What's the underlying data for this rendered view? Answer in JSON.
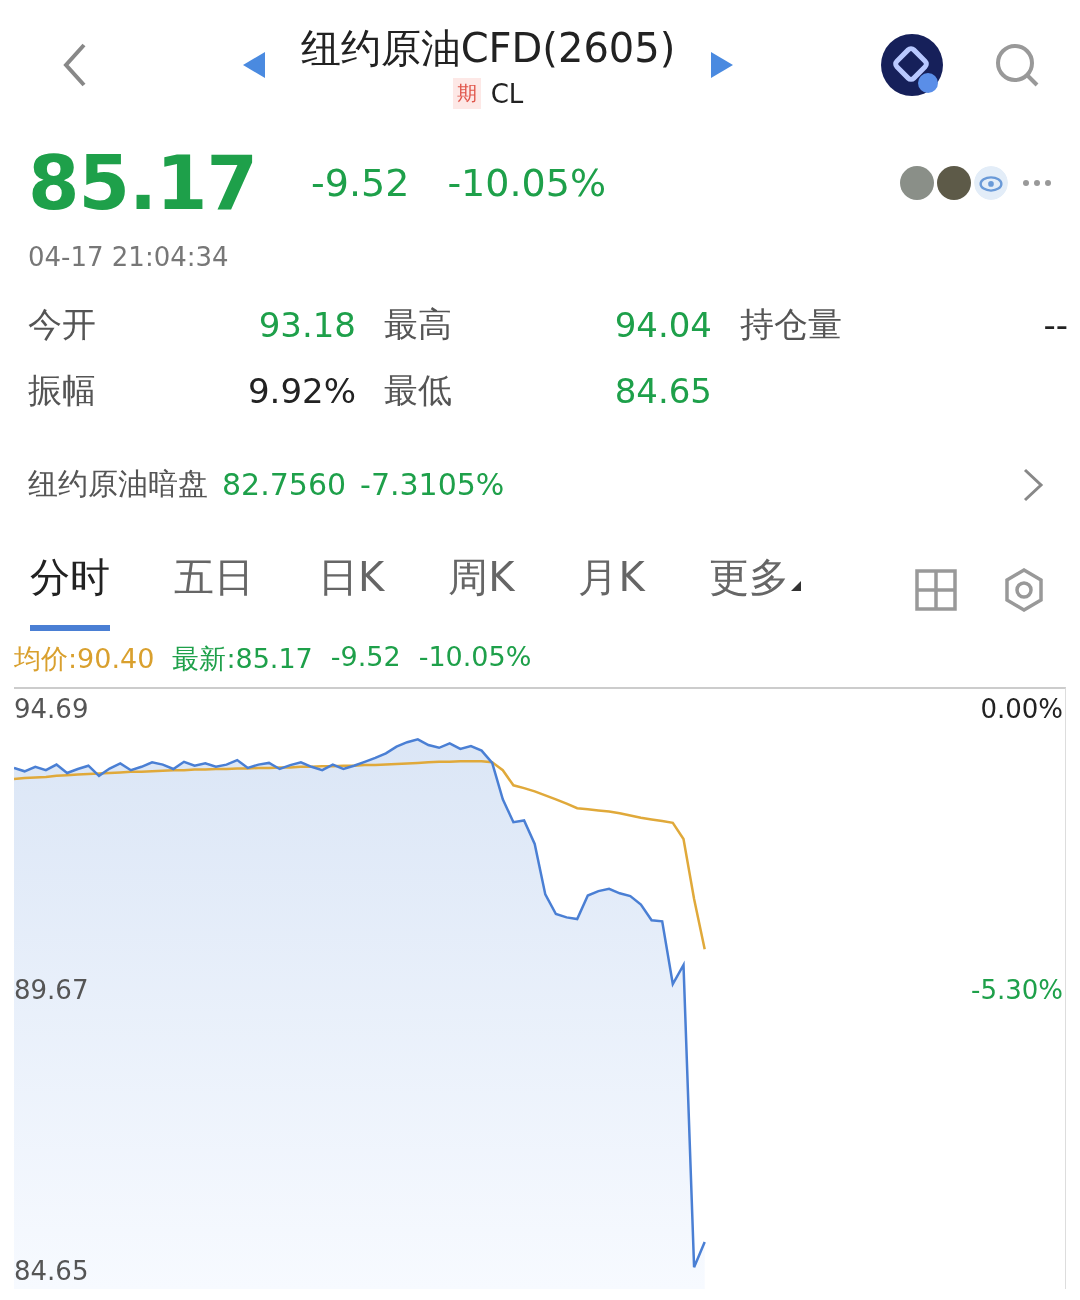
{
  "header": {
    "title": "纽约原油CFD(2605)",
    "badge": "期",
    "code": "CL"
  },
  "quote": {
    "price": "85.17",
    "change": "-9.52",
    "change_pct": "-10.05%",
    "time": "04-17 21:04:34"
  },
  "stats": [
    {
      "label": "今开",
      "value": "93.18",
      "color": "#1ea04a"
    },
    {
      "label": "最高",
      "value": "94.04",
      "color": "#1ea04a"
    },
    {
      "label": "持仓量",
      "value": "--",
      "color": "#222222"
    },
    {
      "label": "振幅",
      "value": "9.92%",
      "color": "#222222"
    },
    {
      "label": "最低",
      "value": "84.65",
      "color": "#1ea04a"
    }
  ],
  "dark_pool": {
    "label": "纽约原油暗盘",
    "price": "82.7560",
    "change_pct": "-7.3105%"
  },
  "tabs": [
    {
      "label": "分时",
      "selected": true,
      "dropdown": false
    },
    {
      "label": "五日",
      "selected": false,
      "dropdown": false
    },
    {
      "label": "日K",
      "selected": false,
      "dropdown": false
    },
    {
      "label": "周K",
      "selected": false,
      "dropdown": false
    },
    {
      "label": "月K",
      "selected": false,
      "dropdown": false
    },
    {
      "label": "更多",
      "selected": false,
      "dropdown": true
    }
  ],
  "legend": {
    "average": "均价:90.40",
    "latest": "最新:85.17",
    "change": "-9.52",
    "change_pct": "-10.05%"
  },
  "chart": {
    "pct_labels": [
      "0.00%",
      "-5.30%"
    ],
    "chart_data": {
      "type": "line",
      "ylim": [
        84.33,
        95.05
      ],
      "yticks": [
        94.69,
        89.67,
        84.65
      ],
      "series": [
        {
          "color": "#4a7fd4",
          "values": [
            93.64,
            93.58,
            93.66,
            93.6,
            93.7,
            93.55,
            93.62,
            93.68,
            93.5,
            93.63,
            93.72,
            93.6,
            93.66,
            93.74,
            93.7,
            93.62,
            93.75,
            93.68,
            93.72,
            93.66,
            93.7,
            93.78,
            93.64,
            93.7,
            93.73,
            93.62,
            93.69,
            93.74,
            93.66,
            93.6,
            93.7,
            93.62,
            93.68,
            93.75,
            93.82,
            93.9,
            94.02,
            94.1,
            94.15,
            94.05,
            94.0,
            94.08,
            93.98,
            94.03,
            93.95,
            93.73,
            93.08,
            92.67,
            92.7,
            92.28,
            91.38,
            91.03,
            90.97,
            90.94,
            91.36,
            91.44,
            91.48,
            91.4,
            91.35,
            91.2,
            90.92,
            90.9,
            89.78,
            90.12,
            84.72,
            85.17,
            null,
            null,
            null,
            null,
            null,
            null,
            null,
            null,
            null,
            null,
            null,
            null,
            null,
            null,
            null,
            null,
            null,
            null,
            null,
            null,
            null,
            null,
            null,
            null,
            null,
            null,
            null,
            null,
            null,
            null,
            null,
            null,
            null,
            null
          ]
        },
        {
          "color": "#e0a93a",
          "values": [
            93.44,
            93.46,
            93.47,
            93.48,
            93.5,
            93.51,
            93.52,
            93.53,
            93.54,
            93.55,
            93.56,
            93.57,
            93.57,
            93.58,
            93.59,
            93.6,
            93.6,
            93.61,
            93.61,
            93.62,
            93.62,
            93.63,
            93.63,
            93.64,
            93.64,
            93.65,
            93.65,
            93.66,
            93.66,
            93.67,
            93.67,
            93.68,
            93.68,
            93.69,
            93.69,
            93.7,
            93.71,
            93.72,
            93.73,
            93.74,
            93.75,
            93.75,
            93.76,
            93.76,
            93.76,
            93.74,
            93.6,
            93.33,
            93.28,
            93.22,
            93.15,
            93.08,
            93.0,
            92.92,
            92.9,
            92.88,
            92.86,
            92.83,
            92.79,
            92.75,
            92.72,
            92.69,
            92.66,
            92.37,
            91.3,
            90.4,
            null,
            null,
            null,
            null,
            null,
            null,
            null,
            null,
            null,
            null,
            null,
            null,
            null,
            null,
            null,
            null,
            null,
            null,
            null,
            null,
            null,
            null,
            null,
            null,
            null,
            null,
            null,
            null,
            null,
            null,
            null,
            null,
            null,
            null
          ]
        }
      ]
    }
  }
}
